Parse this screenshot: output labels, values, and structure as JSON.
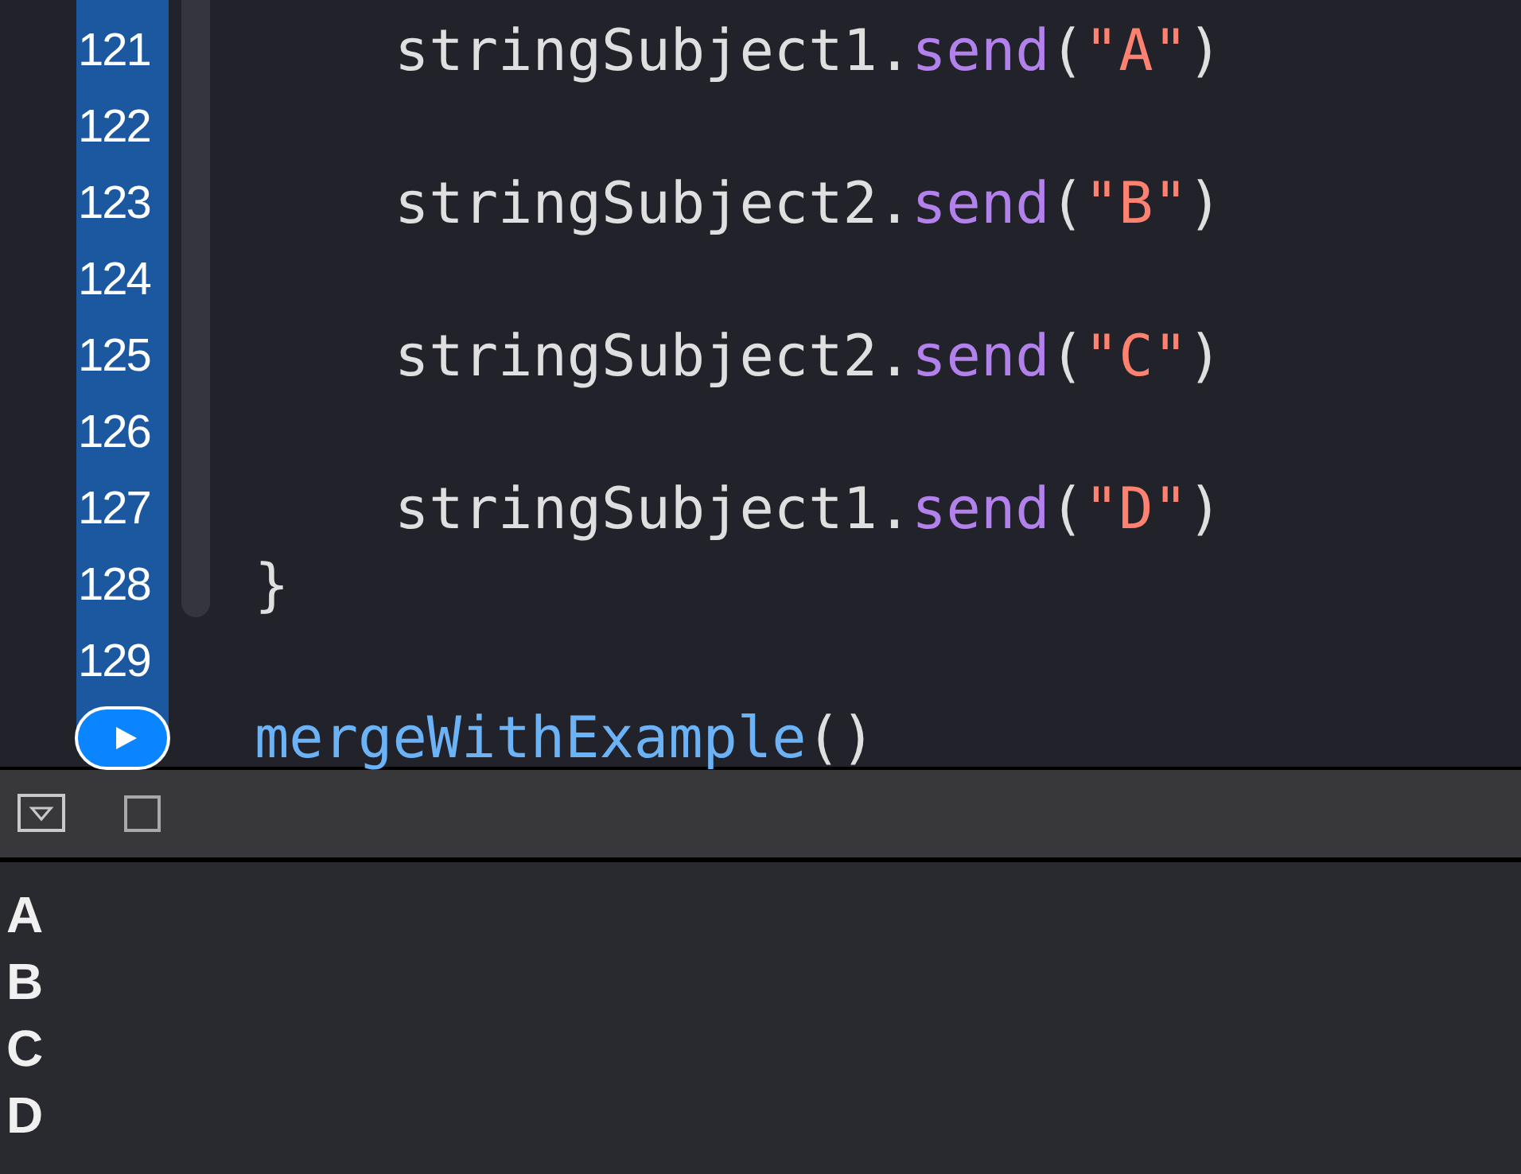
{
  "editor": {
    "lines": [
      {
        "number": "121",
        "kind": "statement",
        "tokens": [
          {
            "kind": "plain",
            "text": "stringSubject1."
          },
          {
            "kind": "method",
            "text": "send"
          },
          {
            "kind": "plain",
            "text": "("
          },
          {
            "kind": "string",
            "text": "\"A\""
          },
          {
            "kind": "plain",
            "text": ")"
          }
        ]
      },
      {
        "number": "122",
        "kind": "blank"
      },
      {
        "number": "123",
        "kind": "statement",
        "tokens": [
          {
            "kind": "plain",
            "text": "stringSubject2."
          },
          {
            "kind": "method",
            "text": "send"
          },
          {
            "kind": "plain",
            "text": "("
          },
          {
            "kind": "string",
            "text": "\"B\""
          },
          {
            "kind": "plain",
            "text": ")"
          }
        ]
      },
      {
        "number": "124",
        "kind": "blank"
      },
      {
        "number": "125",
        "kind": "statement",
        "tokens": [
          {
            "kind": "plain",
            "text": "stringSubject2."
          },
          {
            "kind": "method",
            "text": "send"
          },
          {
            "kind": "plain",
            "text": "("
          },
          {
            "kind": "string",
            "text": "\"C\""
          },
          {
            "kind": "plain",
            "text": ")"
          }
        ]
      },
      {
        "number": "126",
        "kind": "blank"
      },
      {
        "number": "127",
        "kind": "statement",
        "tokens": [
          {
            "kind": "plain",
            "text": "stringSubject1."
          },
          {
            "kind": "method",
            "text": "send"
          },
          {
            "kind": "plain",
            "text": "("
          },
          {
            "kind": "string",
            "text": "\"D\""
          },
          {
            "kind": "plain",
            "text": ")"
          }
        ]
      },
      {
        "number": "128",
        "kind": "top",
        "tokens": [
          {
            "kind": "plain",
            "text": "}"
          }
        ]
      },
      {
        "number": "129",
        "kind": "blank"
      },
      {
        "kind": "run",
        "tokens": [
          {
            "kind": "function",
            "text": "mergeWithExample"
          },
          {
            "kind": "plain",
            "text": "()"
          }
        ]
      }
    ]
  },
  "console": {
    "output": [
      "A",
      "B",
      "C",
      "D"
    ]
  }
}
